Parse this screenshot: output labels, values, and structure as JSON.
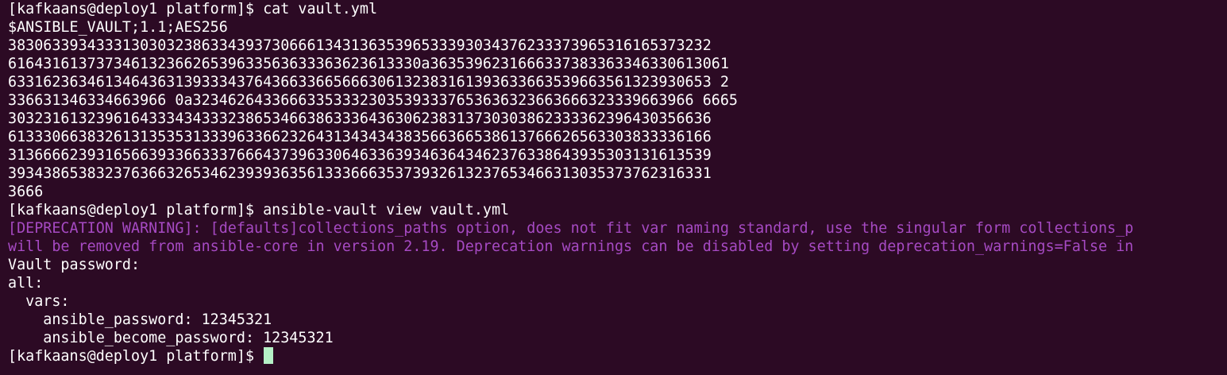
{
  "terminal": {
    "lines": [
      {
        "text": "[kafkaans@deploy1 platform]$ cat vault.yml",
        "kind": "prompt-command"
      },
      {
        "text": "$ANSIBLE_VAULT;1.1;AES256",
        "kind": "output"
      },
      {
        "text": "38306339343331303032386334393730666134313635396533393034376233373965316165373232",
        "kind": "output"
      },
      {
        "text": "61643161373734613236626539633563633363623613330a3635396231666337383363346330613061",
        "kind": "output"
      },
      {
        "text": "63316236346134643631393334376436633665666306132383161393633663539663561323930653 2",
        "kind": "output"
      },
      {
        "text": "336631346334663966 0a323462643366633533323035393337653636323663666323339663966 6665",
        "kind": "output"
      },
      {
        "text": "30323161323961643334343332386534663863336436306238313730303862333362396430356636",
        "kind": "output"
      },
      {
        "text": "61333066383261313535313339633662326431343434383566366538613766626563303833336166",
        "kind": "output"
      },
      {
        "text": "31366662393165663933663337666437396330646336393463643462376338643935303131613539",
        "kind": "output"
      },
      {
        "text": "39343865383237636632653462393936356133366635373932613237653466313035373762316331",
        "kind": "output"
      },
      {
        "text": "3666",
        "kind": "output"
      },
      {
        "text": "[kafkaans@deploy1 platform]$ ansible-vault view vault.yml",
        "kind": "prompt-command"
      },
      {
        "text": "[DEPRECATION WARNING]: [defaults]collections_paths option, does not fit var naming standard, use the singular form collections_p",
        "kind": "warning"
      },
      {
        "text": "will be removed from ansible-core in version 2.19. Deprecation warnings can be disabled by setting deprecation_warnings=False in",
        "kind": "warning"
      },
      {
        "text": "Vault password:",
        "kind": "output"
      },
      {
        "text": "all:",
        "kind": "output"
      },
      {
        "text": "  vars:",
        "kind": "output"
      },
      {
        "text": "    ansible_password: 12345321",
        "kind": "output"
      },
      {
        "text": "    ansible_become_password: 12345321",
        "kind": "output"
      }
    ],
    "current_prompt": "[kafkaans@deploy1 platform]$ ",
    "colors": {
      "background": "#2c0a24",
      "foreground": "#ffffff",
      "warning": "#a64ac3",
      "cursor": "#b5f0c6"
    }
  }
}
